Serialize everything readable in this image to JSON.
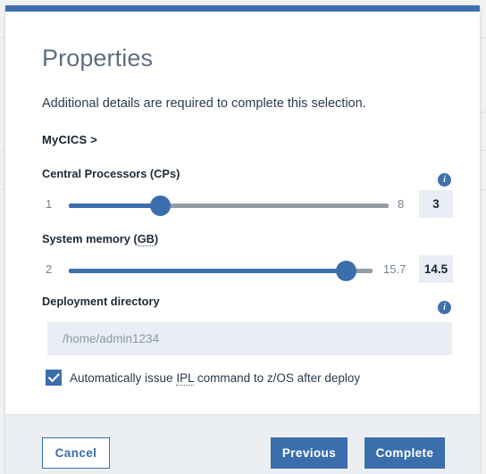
{
  "theme": {
    "accent": "#3a6ead",
    "topbar": "#3f6fb0",
    "track_inactive": "#939ba3",
    "value_box_bg": "#e8edf5",
    "input_bg": "#e9eef4",
    "footer_bg": "#eceff1",
    "title_color": "#5f6e80"
  },
  "dialog": {
    "title": "Properties",
    "subtitle": "Additional details are required to complete this selection.",
    "breadcrumb": "MyCICS >",
    "close_icon": "close-icon",
    "close_glyph": "✕"
  },
  "fields": {
    "cps": {
      "label": "Central Processors (CPs)",
      "info_icon": "info-icon",
      "info_glyph": "i",
      "min": "1",
      "max": "8",
      "value": "3",
      "min_num": 1,
      "max_num": 8,
      "value_num": 3
    },
    "memory": {
      "label": "System memory (GB)",
      "label_plain": "System memory (",
      "label_abbr": "GB",
      "label_tail": ")",
      "info_icon": "info-icon",
      "min": "2",
      "max": "15.7",
      "value": "14.5",
      "min_num": 2,
      "max_num": 15.7,
      "value_num": 14.5
    },
    "directory": {
      "label": "Deployment directory",
      "info_icon": "info-icon",
      "value": "",
      "placeholder": "/home/admin1234"
    },
    "auto_ipl": {
      "checked": true,
      "label_before": "Automatically issue ",
      "label_abbr": "IPL",
      "label_after": " command to z/OS after deploy"
    }
  },
  "footer": {
    "cancel_label": "Cancel",
    "previous_label": "Previous",
    "complete_label": "Complete"
  }
}
